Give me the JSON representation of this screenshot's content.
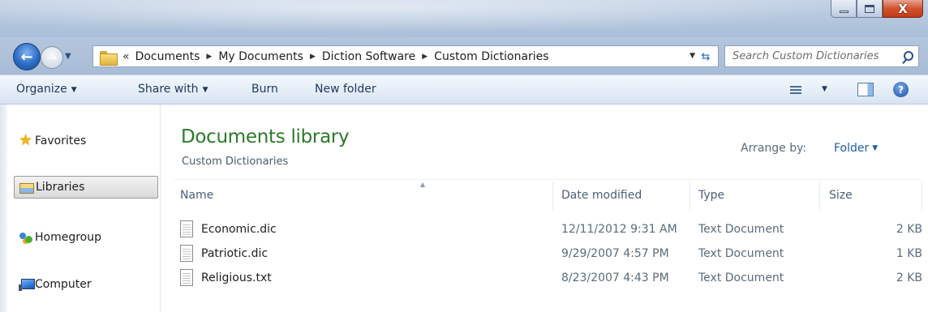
{
  "window": {
    "minimize_glyph": "—",
    "close_glyph": "X"
  },
  "address": {
    "more_glyph": "«",
    "crumbs": [
      "Documents",
      "My Documents",
      "Diction Software",
      "Custom Dictionaries"
    ],
    "search_placeholder": "Search Custom Dictionaries"
  },
  "toolbar": {
    "organize": "Organize",
    "share_with": "Share with",
    "burn": "Burn",
    "new_folder": "New folder"
  },
  "nav": {
    "favorites": "Favorites",
    "libraries": "Libraries",
    "homegroup": "Homegroup",
    "computer": "Computer"
  },
  "library": {
    "title": "Documents library",
    "subtitle": "Custom Dictionaries",
    "arrange_label": "Arrange by:",
    "arrange_value": "Folder"
  },
  "columns": {
    "name": "Name",
    "date_modified": "Date modified",
    "type": "Type",
    "size": "Size"
  },
  "files": [
    {
      "name": "Economic.dic",
      "date": "12/11/2012 9:31 AM",
      "type": "Text Document",
      "size": "2 KB"
    },
    {
      "name": "Patriotic.dic",
      "date": "9/29/2007 4:57 PM",
      "type": "Text Document",
      "size": "1 KB"
    },
    {
      "name": "Religious.txt",
      "date": "8/23/2007 4:43 PM",
      "type": "Text Document",
      "size": "2 KB"
    }
  ]
}
